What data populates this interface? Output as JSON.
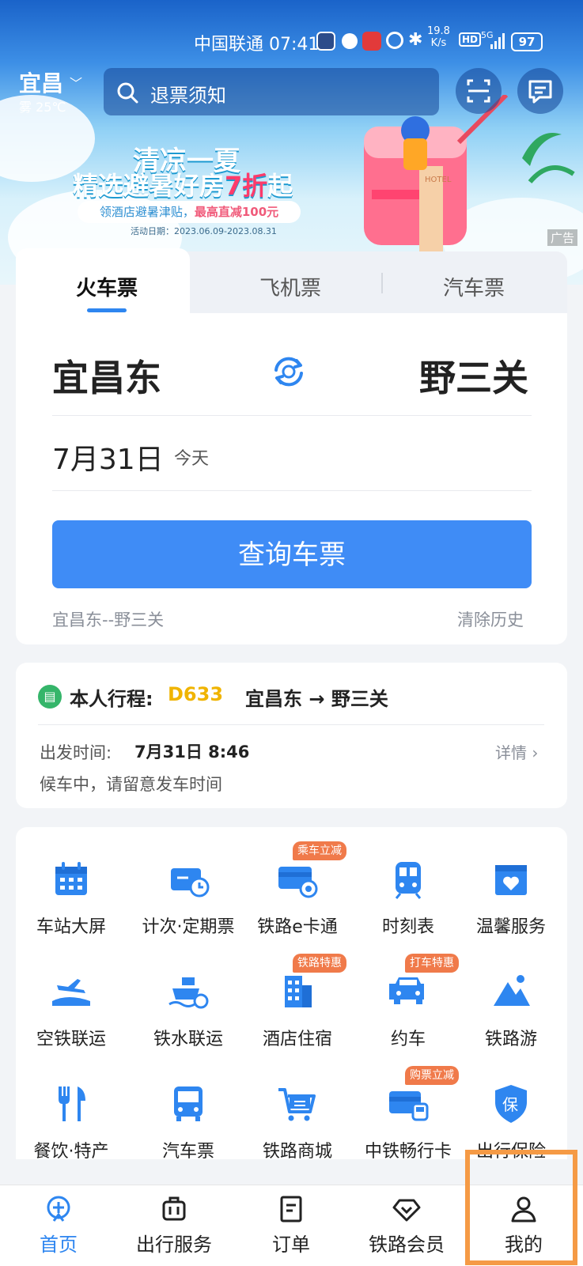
{
  "status_bar": {
    "carrier": "中国联通",
    "time": "07:41",
    "speed": "19.8",
    "speed_unit": "K/s",
    "hd": "HD",
    "net": "5G",
    "battery": "97"
  },
  "header": {
    "city": "宜昌",
    "weather": "雾 25℃",
    "search_placeholder": "退票须知"
  },
  "banner": {
    "line1": "清凉一夏",
    "line2_prefix": "精选避暑好房",
    "line2_highlight": "7折",
    "line2_suffix": "起",
    "pill_prefix": "领酒店避暑津贴，",
    "pill_highlight": "最高直减100元",
    "date": "活动日期：2023.06.09-2023.08.31",
    "hotel_sign": "HOTEL",
    "ad_label": "广告"
  },
  "ticket_tabs": [
    "火车票",
    "飞机票",
    "汽车票"
  ],
  "ticket": {
    "from": "宜昌东",
    "to": "野三关",
    "date": "7月31日",
    "date_hint": "今天",
    "query_button": "查询车票",
    "history": "宜昌东--野三关",
    "clear_history": "清除历史"
  },
  "trip": {
    "label": "本人行程:",
    "train": "D633",
    "route": "宜昌东 → 野三关",
    "departure_label": "出发时间:",
    "departure": "7月31日 8:46",
    "detail": "详情",
    "status": "候车中，请留意发车时间"
  },
  "services": [
    {
      "label": "车站大屏",
      "icon": "calendar-icon",
      "badge": ""
    },
    {
      "label": "计次·定期票",
      "icon": "ticket-clock-icon",
      "badge": ""
    },
    {
      "label": "铁路e卡通",
      "icon": "card-icon",
      "badge": "乘车立减"
    },
    {
      "label": "时刻表",
      "icon": "train-icon",
      "badge": ""
    },
    {
      "label": "温馨服务",
      "icon": "heart-box-icon",
      "badge": ""
    },
    {
      "label": "空铁联运",
      "icon": "plane-train-icon",
      "badge": ""
    },
    {
      "label": "铁水联运",
      "icon": "ship-icon",
      "badge": ""
    },
    {
      "label": "酒店住宿",
      "icon": "hotel-icon",
      "badge": "铁路特惠"
    },
    {
      "label": "约车",
      "icon": "car-icon",
      "badge": "打车特惠"
    },
    {
      "label": "铁路游",
      "icon": "mountain-icon",
      "badge": ""
    },
    {
      "label": "餐饮·特产",
      "icon": "utensils-icon",
      "badge": ""
    },
    {
      "label": "汽车票",
      "icon": "bus-icon",
      "badge": ""
    },
    {
      "label": "铁路商城",
      "icon": "cart-icon",
      "badge": ""
    },
    {
      "label": "中铁畅行卡",
      "icon": "pass-card-icon",
      "badge": "购票立减"
    },
    {
      "label": "出行保险",
      "icon": "shield-icon",
      "badge": ""
    }
  ],
  "insurance_char": "保",
  "nav": [
    {
      "label": "首页",
      "active": true
    },
    {
      "label": "出行服务",
      "active": false
    },
    {
      "label": "订单",
      "active": false
    },
    {
      "label": "铁路会员",
      "active": false
    },
    {
      "label": "我的",
      "active": false
    }
  ],
  "colors": {
    "primary": "#3f8cf6",
    "accent_orange": "#f07a4a",
    "train_no": "#f0b400",
    "highlight": "#f59a45"
  }
}
